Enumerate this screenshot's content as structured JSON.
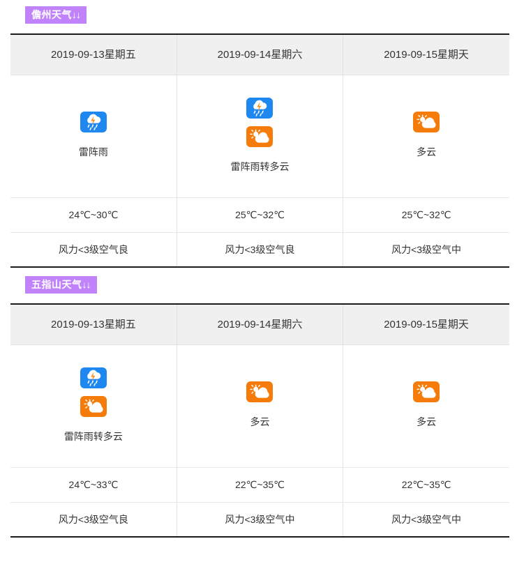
{
  "sections": [
    {
      "badge_label": "儋州天气",
      "badge_arrows": "↓↓",
      "badge_color": "#c183fc",
      "columns": [
        {
          "header": "2019-09-13星期五",
          "icons": [
            "thunderstorm-icon"
          ],
          "condition": "雷阵雨",
          "temperature": "24℃~30℃",
          "wind_air": "风力<3级空气良"
        },
        {
          "header": "2019-09-14星期六",
          "icons": [
            "thunderstorm-icon",
            "partly-cloudy-icon"
          ],
          "condition": "雷阵雨转多云",
          "temperature": "25℃~32℃",
          "wind_air": "风力<3级空气良"
        },
        {
          "header": "2019-09-15星期天",
          "icons": [
            "partly-cloudy-icon"
          ],
          "condition": "多云",
          "temperature": "25℃~32℃",
          "wind_air": "风力<3级空气中"
        }
      ]
    },
    {
      "badge_label": "五指山天气",
      "badge_arrows": "↓↓",
      "badge_color": "#c183fc",
      "columns": [
        {
          "header": "2019-09-13星期五",
          "icons": [
            "thunderstorm-icon",
            "partly-cloudy-icon"
          ],
          "condition": "雷阵雨转多云",
          "temperature": "24℃~33℃",
          "wind_air": "风力<3级空气良"
        },
        {
          "header": "2019-09-14星期六",
          "icons": [
            "partly-cloudy-icon"
          ],
          "condition": "多云",
          "temperature": "22℃~35℃",
          "wind_air": "风力<3级空气中"
        },
        {
          "header": "2019-09-15星期天",
          "icons": [
            "partly-cloudy-icon"
          ],
          "condition": "多云",
          "temperature": "22℃~35℃",
          "wind_air": "风力<3级空气中"
        }
      ]
    }
  ],
  "icon_colors": {
    "thunderstorm_bg": "#1e88f0",
    "partly_cloudy_bg": "#f57c0a",
    "cloud_white": "#ffffff",
    "bolt_orange": "#f7941e"
  }
}
